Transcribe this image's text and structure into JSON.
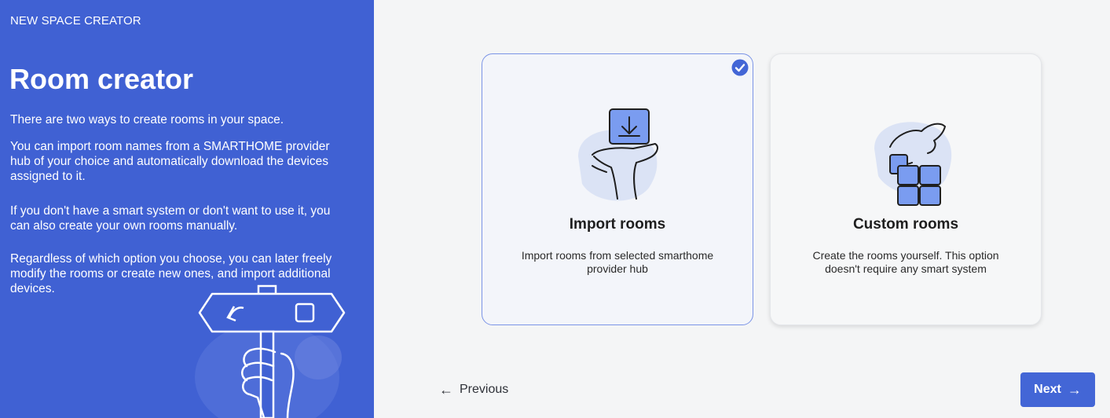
{
  "sidebar": {
    "eyebrow": "NEW SPACE CREATOR",
    "title": "Room creator",
    "paragraphs": [
      "There are two ways to create rooms in your space.",
      "You can import room names from a SMARTHOME provider hub of your choice and automatically download the devices assigned to it.",
      "If you don't have a smart system or don't want to use it, you can also create your own rooms manually.",
      "Regardless of which option you choose, you can later freely modify the rooms or create new ones, and import additional devices."
    ],
    "illustration_icon": "signpost-hand-icon"
  },
  "options": [
    {
      "title": "Import rooms",
      "description": "Import rooms from selected smarthome provider hub",
      "icon": "hand-download-icon",
      "selected": true
    },
    {
      "title": "Custom rooms",
      "description": "Create the rooms yourself. This option doesn't require any smart system",
      "icon": "hand-blocks-icon",
      "selected": false
    }
  ],
  "footer": {
    "previous_label": "Previous",
    "next_label": "Next",
    "previous_icon": "arrow-left-icon",
    "next_icon": "arrow-right-icon"
  },
  "colors": {
    "sidebar_bg": "#4061d3",
    "accent": "#4366d6",
    "selected_border": "#7b94e6",
    "page_bg": "#f4f5f6"
  }
}
